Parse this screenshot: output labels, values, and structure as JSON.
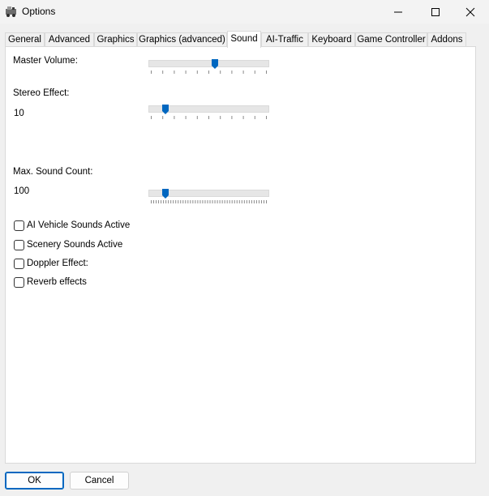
{
  "window": {
    "title": "Options",
    "icon": "app-icon"
  },
  "tabs": [
    {
      "label": "General"
    },
    {
      "label": "Advanced"
    },
    {
      "label": "Graphics"
    },
    {
      "label": "Graphics (advanced)"
    },
    {
      "label": "Sound",
      "active": true
    },
    {
      "label": "AI-Traffic"
    },
    {
      "label": "Keyboard"
    },
    {
      "label": "Game Controller"
    },
    {
      "label": "Addons"
    }
  ],
  "sound": {
    "master_volume": {
      "label": "Master Volume:",
      "level": 0.55
    },
    "stereo_effect": {
      "label": "Stereo Effect:",
      "value": "10",
      "level": 0.12
    },
    "max_sound_count": {
      "label": "Max. Sound Count:",
      "value": "100",
      "level": 0.12
    },
    "checkboxes": [
      {
        "label": "AI Vehicle Sounds Active",
        "checked": false
      },
      {
        "label": "Scenery Sounds Active",
        "checked": false
      },
      {
        "label": "Doppler Effect:",
        "checked": false
      },
      {
        "label": "Reverb effects",
        "checked": false
      }
    ]
  },
  "buttons": {
    "ok": "OK",
    "cancel": "Cancel"
  },
  "colors": {
    "accent": "#0067c0"
  }
}
